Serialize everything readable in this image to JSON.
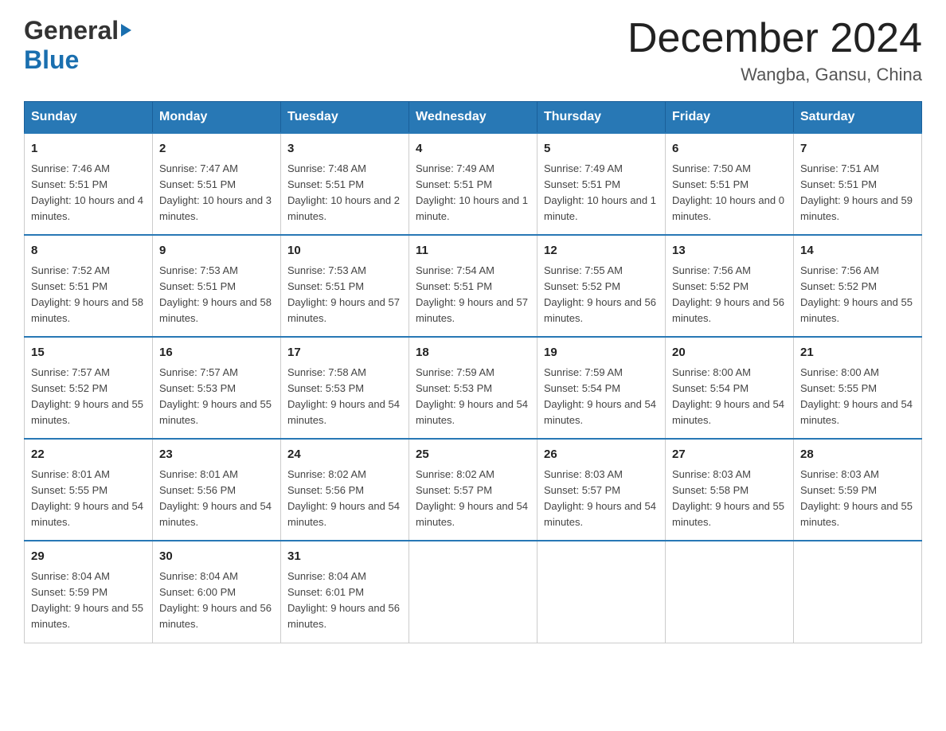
{
  "header": {
    "logo_general": "General",
    "logo_blue": "Blue",
    "title": "December 2024",
    "subtitle": "Wangba, Gansu, China"
  },
  "days_of_week": [
    "Sunday",
    "Monday",
    "Tuesday",
    "Wednesday",
    "Thursday",
    "Friday",
    "Saturday"
  ],
  "weeks": [
    [
      {
        "day": "1",
        "sunrise": "7:46 AM",
        "sunset": "5:51 PM",
        "daylight": "10 hours and 4 minutes."
      },
      {
        "day": "2",
        "sunrise": "7:47 AM",
        "sunset": "5:51 PM",
        "daylight": "10 hours and 3 minutes."
      },
      {
        "day": "3",
        "sunrise": "7:48 AM",
        "sunset": "5:51 PM",
        "daylight": "10 hours and 2 minutes."
      },
      {
        "day": "4",
        "sunrise": "7:49 AM",
        "sunset": "5:51 PM",
        "daylight": "10 hours and 1 minute."
      },
      {
        "day": "5",
        "sunrise": "7:49 AM",
        "sunset": "5:51 PM",
        "daylight": "10 hours and 1 minute."
      },
      {
        "day": "6",
        "sunrise": "7:50 AM",
        "sunset": "5:51 PM",
        "daylight": "10 hours and 0 minutes."
      },
      {
        "day": "7",
        "sunrise": "7:51 AM",
        "sunset": "5:51 PM",
        "daylight": "9 hours and 59 minutes."
      }
    ],
    [
      {
        "day": "8",
        "sunrise": "7:52 AM",
        "sunset": "5:51 PM",
        "daylight": "9 hours and 58 minutes."
      },
      {
        "day": "9",
        "sunrise": "7:53 AM",
        "sunset": "5:51 PM",
        "daylight": "9 hours and 58 minutes."
      },
      {
        "day": "10",
        "sunrise": "7:53 AM",
        "sunset": "5:51 PM",
        "daylight": "9 hours and 57 minutes."
      },
      {
        "day": "11",
        "sunrise": "7:54 AM",
        "sunset": "5:51 PM",
        "daylight": "9 hours and 57 minutes."
      },
      {
        "day": "12",
        "sunrise": "7:55 AM",
        "sunset": "5:52 PM",
        "daylight": "9 hours and 56 minutes."
      },
      {
        "day": "13",
        "sunrise": "7:56 AM",
        "sunset": "5:52 PM",
        "daylight": "9 hours and 56 minutes."
      },
      {
        "day": "14",
        "sunrise": "7:56 AM",
        "sunset": "5:52 PM",
        "daylight": "9 hours and 55 minutes."
      }
    ],
    [
      {
        "day": "15",
        "sunrise": "7:57 AM",
        "sunset": "5:52 PM",
        "daylight": "9 hours and 55 minutes."
      },
      {
        "day": "16",
        "sunrise": "7:57 AM",
        "sunset": "5:53 PM",
        "daylight": "9 hours and 55 minutes."
      },
      {
        "day": "17",
        "sunrise": "7:58 AM",
        "sunset": "5:53 PM",
        "daylight": "9 hours and 54 minutes."
      },
      {
        "day": "18",
        "sunrise": "7:59 AM",
        "sunset": "5:53 PM",
        "daylight": "9 hours and 54 minutes."
      },
      {
        "day": "19",
        "sunrise": "7:59 AM",
        "sunset": "5:54 PM",
        "daylight": "9 hours and 54 minutes."
      },
      {
        "day": "20",
        "sunrise": "8:00 AM",
        "sunset": "5:54 PM",
        "daylight": "9 hours and 54 minutes."
      },
      {
        "day": "21",
        "sunrise": "8:00 AM",
        "sunset": "5:55 PM",
        "daylight": "9 hours and 54 minutes."
      }
    ],
    [
      {
        "day": "22",
        "sunrise": "8:01 AM",
        "sunset": "5:55 PM",
        "daylight": "9 hours and 54 minutes."
      },
      {
        "day": "23",
        "sunrise": "8:01 AM",
        "sunset": "5:56 PM",
        "daylight": "9 hours and 54 minutes."
      },
      {
        "day": "24",
        "sunrise": "8:02 AM",
        "sunset": "5:56 PM",
        "daylight": "9 hours and 54 minutes."
      },
      {
        "day": "25",
        "sunrise": "8:02 AM",
        "sunset": "5:57 PM",
        "daylight": "9 hours and 54 minutes."
      },
      {
        "day": "26",
        "sunrise": "8:03 AM",
        "sunset": "5:57 PM",
        "daylight": "9 hours and 54 minutes."
      },
      {
        "day": "27",
        "sunrise": "8:03 AM",
        "sunset": "5:58 PM",
        "daylight": "9 hours and 55 minutes."
      },
      {
        "day": "28",
        "sunrise": "8:03 AM",
        "sunset": "5:59 PM",
        "daylight": "9 hours and 55 minutes."
      }
    ],
    [
      {
        "day": "29",
        "sunrise": "8:04 AM",
        "sunset": "5:59 PM",
        "daylight": "9 hours and 55 minutes."
      },
      {
        "day": "30",
        "sunrise": "8:04 AM",
        "sunset": "6:00 PM",
        "daylight": "9 hours and 56 minutes."
      },
      {
        "day": "31",
        "sunrise": "8:04 AM",
        "sunset": "6:01 PM",
        "daylight": "9 hours and 56 minutes."
      },
      null,
      null,
      null,
      null
    ]
  ],
  "labels": {
    "sunrise": "Sunrise:",
    "sunset": "Sunset:",
    "daylight": "Daylight:"
  }
}
